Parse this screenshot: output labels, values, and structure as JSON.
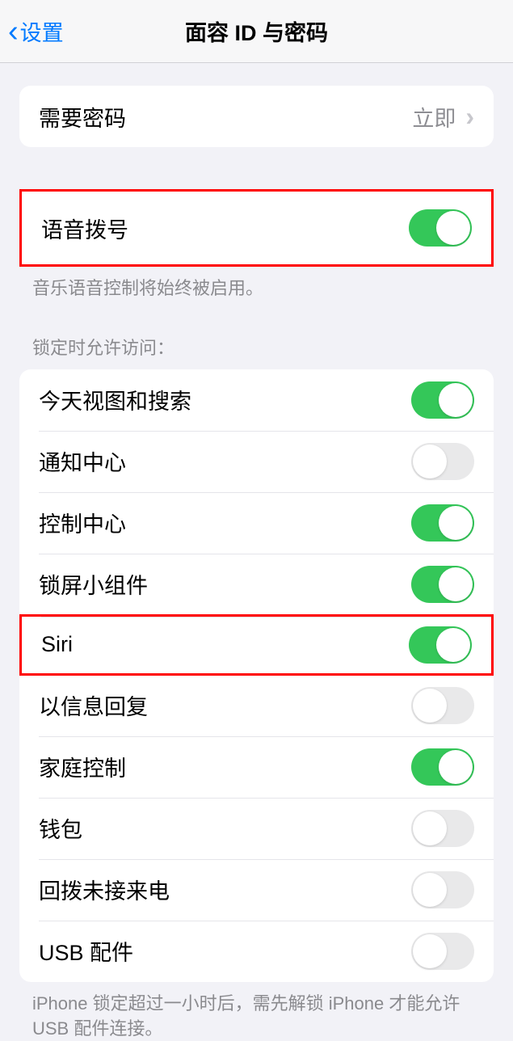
{
  "header": {
    "back_label": "设置",
    "title": "面容 ID 与密码"
  },
  "group1": {
    "require_passcode_label": "需要密码",
    "require_passcode_value": "立即"
  },
  "voice_dial": {
    "label": "语音拨号",
    "on": true,
    "footer": "音乐语音控制将始终被启用。"
  },
  "lock_section": {
    "header": "锁定时允许访问：",
    "items": [
      {
        "label": "今天视图和搜索",
        "on": true
      },
      {
        "label": "通知中心",
        "on": false
      },
      {
        "label": "控制中心",
        "on": true
      },
      {
        "label": "锁屏小组件",
        "on": true
      },
      {
        "label": "Siri",
        "on": true
      },
      {
        "label": "以信息回复",
        "on": false
      },
      {
        "label": "家庭控制",
        "on": true
      },
      {
        "label": "钱包",
        "on": false
      },
      {
        "label": "回拨未接来电",
        "on": false
      },
      {
        "label": "USB 配件",
        "on": false
      }
    ],
    "footer": "iPhone 锁定超过一小时后，需先解锁 iPhone 才能允许 USB 配件连接。"
  }
}
